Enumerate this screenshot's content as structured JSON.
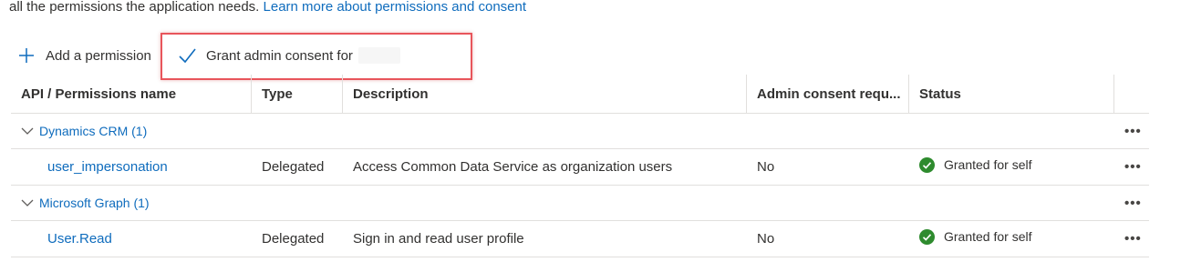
{
  "intro": {
    "text": "all the permissions the application needs.",
    "link": "Learn more about permissions and consent"
  },
  "toolbar": {
    "add_label": "Add a permission",
    "grant_label": "Grant admin consent for"
  },
  "table": {
    "headers": {
      "api": "API / Permissions name",
      "type": "Type",
      "description": "Description",
      "admin": "Admin consent requ...",
      "status": "Status"
    },
    "groups": [
      {
        "label": "Dynamics CRM (1)",
        "rows": [
          {
            "name": "user_impersonation",
            "type": "Delegated",
            "description": "Access Common Data Service as organization users",
            "admin": "No",
            "status": "Granted for self"
          }
        ]
      },
      {
        "label": "Microsoft Graph (1)",
        "rows": [
          {
            "name": "User.Read",
            "type": "Delegated",
            "description": "Sign in and read user profile",
            "admin": "No",
            "status": "Granted for self"
          }
        ]
      }
    ],
    "more_label": "•••"
  },
  "colors": {
    "link": "#0f6cbd",
    "highlight": "#e8555b",
    "granted": "#2e8b2e"
  },
  "icons": [
    "plus-icon",
    "checkmark-icon",
    "chevron-down-icon",
    "check-circle-icon",
    "more-icon"
  ]
}
